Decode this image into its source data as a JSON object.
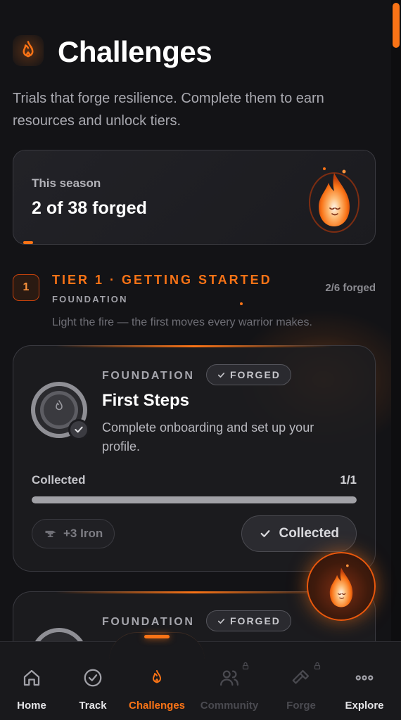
{
  "header": {
    "title": "Challenges",
    "subtitle": "Trials that forge resilience. Complete them to earn resources and unlock tiers."
  },
  "season": {
    "label": "This season",
    "count": "2 of 38 forged"
  },
  "tier": {
    "number": "1",
    "title": "TIER 1 · GETTING STARTED",
    "subtitle": "FOUNDATION",
    "progress": "2/6 forged",
    "description": "Light the fire — the first moves every warrior makes."
  },
  "challenges": [
    {
      "category": "FOUNDATION",
      "status": "FORGED",
      "title": "First Steps",
      "description": "Complete onboarding and set up your profile.",
      "progress_label": "Collected",
      "progress_value": "1/1",
      "progress_fraction": 1.0,
      "reward": "+3 Iron",
      "action_label": "Collected"
    },
    {
      "category": "FOUNDATION",
      "status": "FORGED"
    }
  ],
  "nav": {
    "items": [
      {
        "label": "Home",
        "icon": "home-icon",
        "state": "normal"
      },
      {
        "label": "Track",
        "icon": "check-circle-icon",
        "state": "normal"
      },
      {
        "label": "Challenges",
        "icon": "flame-icon",
        "state": "active"
      },
      {
        "label": "Community",
        "icon": "users-icon",
        "state": "locked"
      },
      {
        "label": "Forge",
        "icon": "hammer-icon",
        "state": "locked"
      },
      {
        "label": "Explore",
        "icon": "more-icon",
        "state": "normal"
      }
    ]
  },
  "colors": {
    "accent": "#f97316",
    "background": "#131316",
    "card": "#1c1c20",
    "muted": "#a9a9b0"
  }
}
